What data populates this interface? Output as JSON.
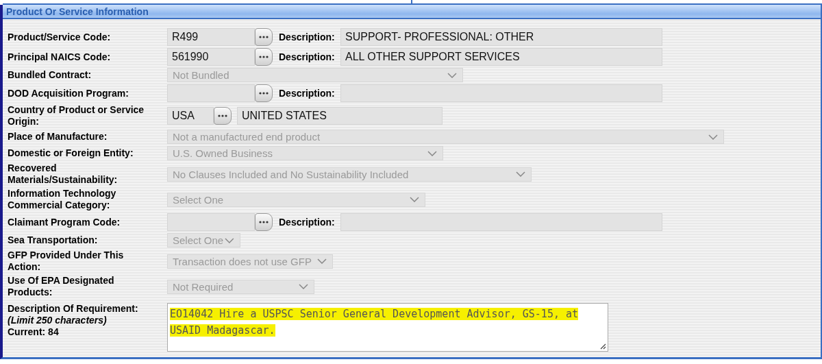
{
  "section": {
    "title": "Product Or Service Information"
  },
  "rows": [
    {
      "kind": "lookup",
      "label": "Product/Service Code:",
      "value": "R499",
      "description_label": "Description:",
      "description": "SUPPORT- PROFESSIONAL: OTHER"
    },
    {
      "kind": "lookup",
      "label": "Principal NAICS Code:",
      "value": "561990",
      "description_label": "Description:",
      "description": "ALL OTHER SUPPORT SERVICES"
    },
    {
      "kind": "select",
      "label": "Bundled Contract:",
      "value": "Not Bundled",
      "disabled": true
    },
    {
      "kind": "lookup",
      "label": "DOD Acquisition Program:",
      "description_label": "Description:"
    },
    {
      "kind": "country",
      "label": "Country of Product or Service Origin:",
      "value": "USA",
      "description": "UNITED STATES"
    },
    {
      "kind": "select",
      "label": "Place of Manufacture:",
      "value": "Not a manufactured end product",
      "disabled": true
    },
    {
      "kind": "select",
      "label": "Domestic or Foreign Entity:",
      "value": "U.S. Owned Business",
      "disabled": true
    },
    {
      "kind": "select",
      "label": "Recovered Materials/Sustainability:",
      "value": "No Clauses Included and No Sustainability Included",
      "disabled": true
    },
    {
      "kind": "select",
      "label": "Information Technology Commercial Category:",
      "value": "Select One",
      "disabled": true
    },
    {
      "kind": "lookup",
      "label": "Claimant Program Code:",
      "description_label": "Description:"
    },
    {
      "kind": "select",
      "label": "Sea Transportation:",
      "value": "Select One",
      "disabled": true
    },
    {
      "kind": "select",
      "label": "GFP Provided Under This Action:",
      "value": "Transaction does not use GFP",
      "disabled": true
    },
    {
      "kind": "select",
      "label": "Use Of EPA Designated Products:",
      "value": "Not Required",
      "disabled": true
    },
    {
      "kind": "textarea",
      "label": "Description Of Requirement:",
      "hint": "(Limit 250 characters)",
      "counter": "Current: 84",
      "value": "EO14042 Hire a USPSC Senior General Development Advisor, GS-15, at USAID Madagascar.",
      "highlighted": true
    }
  ]
}
